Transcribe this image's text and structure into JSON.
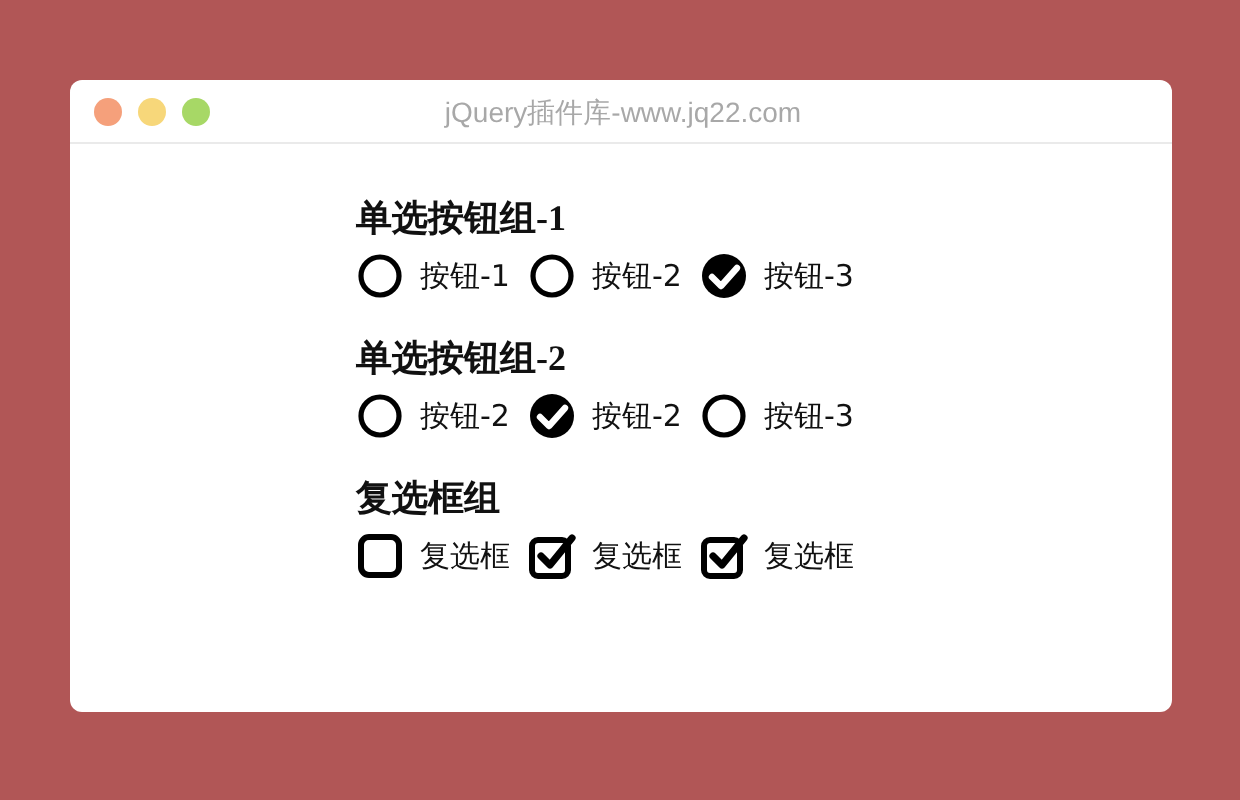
{
  "window": {
    "title": "jQuery插件库-www.jq22.com"
  },
  "groups": [
    {
      "title": "单选按钮组-1",
      "kind": "radio",
      "items": [
        {
          "label": "按钮-1",
          "selected": false
        },
        {
          "label": "按钮-2",
          "selected": false
        },
        {
          "label": "按钮-3",
          "selected": true
        }
      ]
    },
    {
      "title": "单选按钮组-2",
      "kind": "radio",
      "items": [
        {
          "label": "按钮-2",
          "selected": false
        },
        {
          "label": "按钮-2",
          "selected": true
        },
        {
          "label": "按钮-3",
          "selected": false
        }
      ]
    },
    {
      "title": "复选框组",
      "kind": "checkbox",
      "items": [
        {
          "label": "复选框",
          "checked": false
        },
        {
          "label": "复选框",
          "checked": true
        },
        {
          "label": "复选框",
          "checked": true
        }
      ]
    }
  ]
}
